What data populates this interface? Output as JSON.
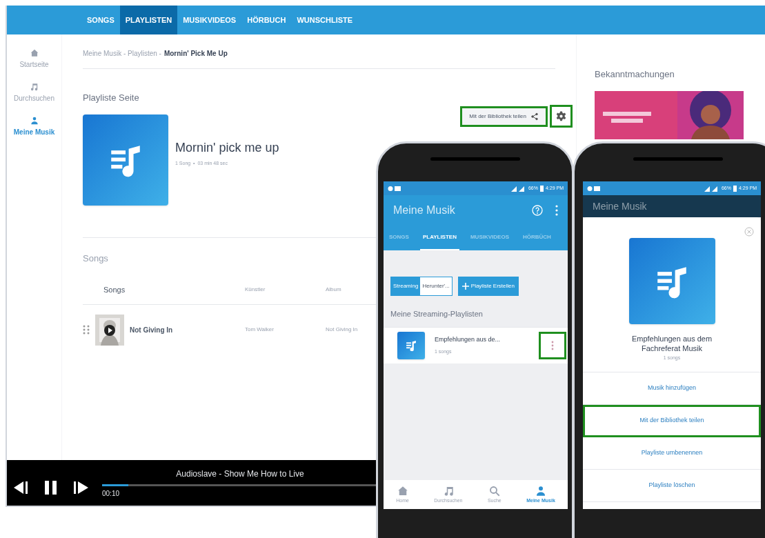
{
  "web": {
    "nav_tabs": [
      {
        "label": "SONGS",
        "selected": false
      },
      {
        "label": "PLAYLISTEN",
        "selected": true
      },
      {
        "label": "MUSIKVIDEOS",
        "selected": false
      },
      {
        "label": "HÖRBUCH",
        "selected": false
      },
      {
        "label": "WUNSCHLISTE",
        "selected": false
      }
    ],
    "sidebar": [
      {
        "kind": "home",
        "label": "Startseite",
        "selected": false
      },
      {
        "kind": "note",
        "label": "Durchsuchen",
        "selected": false
      },
      {
        "kind": "person",
        "label": "Meine Musik",
        "selected": true
      }
    ],
    "breadcrumb": {
      "trail": "Meine Musik - Playlisten -",
      "current": "Mornin' Pick Me Up"
    },
    "section_title": "Playliste Seite",
    "playlist": {
      "title": "Mornin' pick me up",
      "meta": "1 Song  •  03 min 48 sec"
    },
    "share_button": {
      "label": "Mit der Bibliothek teilen",
      "highlighted": true
    },
    "settings_button": {
      "highlighted": true
    },
    "songs_title": "Songs",
    "table": {
      "columns": [
        "Songs",
        "Künstler",
        "Album"
      ],
      "rows": [
        {
          "title": "Not Giving In",
          "artist": "Tom Walker",
          "album": "Not Giving In"
        }
      ]
    },
    "announcements_title": "Bekanntmachungen",
    "player": {
      "track": "Audioslave - Show Me How to Live",
      "time": "00:10",
      "level": 0.04
    }
  },
  "phone_1": {
    "status": {
      "battery": "66%",
      "time": "4:29 PM"
    },
    "title": "Meine Musik",
    "tabs": [
      {
        "label": "SONGS",
        "selected": false
      },
      {
        "label": "PLAYLISTEN",
        "selected": true
      },
      {
        "label": "MUSIKVIDEOS",
        "selected": false
      },
      {
        "label": "HÖRBÜCH",
        "selected": false
      }
    ],
    "segments": [
      {
        "label": "Streaming",
        "selected": true
      },
      {
        "label": "Herunter'...",
        "selected": false
      }
    ],
    "create_button": "Playliste Erstellen",
    "section": "Meine Streaming-Playlisten",
    "items": [
      {
        "title": "Empfehlungen aus de...",
        "subtitle": "1 songs",
        "menu_highlighted": true
      }
    ],
    "bottom_nav": [
      {
        "kind": "home",
        "label": "Home",
        "selected": false
      },
      {
        "kind": "note",
        "label": "Durchsuchen",
        "selected": false
      },
      {
        "kind": "search",
        "label": "Suche",
        "selected": false
      },
      {
        "kind": "person",
        "label": "Meine Musik",
        "selected": true
      }
    ]
  },
  "phone_2": {
    "status": {
      "battery": "66%",
      "time": "4:29 PM"
    },
    "title": "Meine Musik",
    "sheet": {
      "title": "Empfehlungen aus dem Fachreferat Musik",
      "subtitle": "1 songs",
      "actions": [
        {
          "label": "Musik hinzufügen",
          "highlighted": false
        },
        {
          "label": "Mit der Bibliothek teilen",
          "highlighted": true
        },
        {
          "label": "Playliste umbenennen",
          "highlighted": false
        },
        {
          "label": "Playliste löschen",
          "highlighted": false
        }
      ]
    }
  }
}
